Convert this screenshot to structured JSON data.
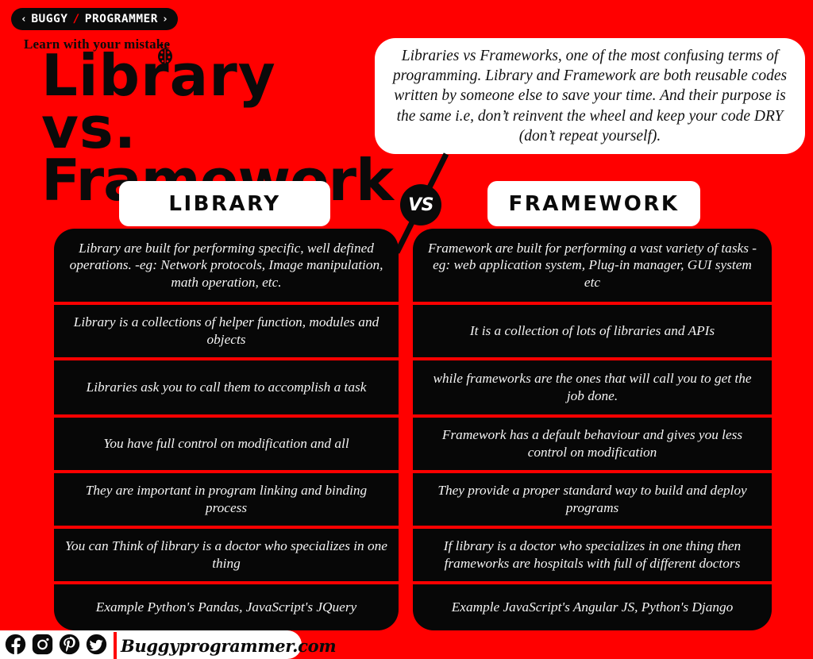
{
  "brand": {
    "chevron_left": "‹",
    "chevron_right": "›",
    "word_one": "BUGGY",
    "slash": "/",
    "word_two": "PROGRAMMER",
    "tagline": "Learn with your mistake"
  },
  "title": {
    "line_1": "Library  vs.",
    "line_2": "Framework"
  },
  "description": "Libraries vs Frameworks, one of the most confusing terms of programming. Library and Framework are both reusable codes written by someone else to save your time. And their purpose is the same i.e, don’t reinvent the wheel and keep your code DRY (don’t repeat yourself).",
  "vs_label": "VS",
  "columns": {
    "left": {
      "header": "LIBRARY",
      "rows": [
        "Library are built for performing specific, well defined operations. -eg: Network protocols, Image manipulation, math operation, etc.",
        "Library is a collections of helper function, modules and objects",
        "Libraries ask you to call them to accomplish a task",
        "You have full control on modification and all",
        "They are important in program linking and binding process",
        "You can Think of library is a doctor who specializes in one thing",
        "Example Python's Pandas, JavaScript's JQuery"
      ]
    },
    "right": {
      "header": "FRAMEWORK",
      "rows": [
        "Framework are built for performing a vast variety of tasks  - eg: web application system, Plug-in manager, GUI system etc",
        "It is a collection of lots of libraries and APIs",
        "while frameworks are the ones that will call you to get the job done.",
        "Framework has a default behaviour and gives you less control on modification",
        "They provide a proper standard way to build and deploy programs",
        "If library is a doctor who specializes in one thing then frameworks are hospitals with full of different doctors",
        "Example JavaScript's Angular JS, Python's Django"
      ]
    }
  },
  "footer": {
    "site_name": "Buggyprogrammer.com",
    "social": [
      {
        "name": "facebook-icon"
      },
      {
        "name": "instagram-icon"
      },
      {
        "name": "pinterest-icon"
      },
      {
        "name": "twitter-icon"
      }
    ]
  },
  "colors": {
    "background_red": "#FF0000",
    "card_black": "#070707",
    "divider_red": "#FF0000",
    "panel_white": "#FFFFFF",
    "text_white": "#F4F4F4"
  }
}
